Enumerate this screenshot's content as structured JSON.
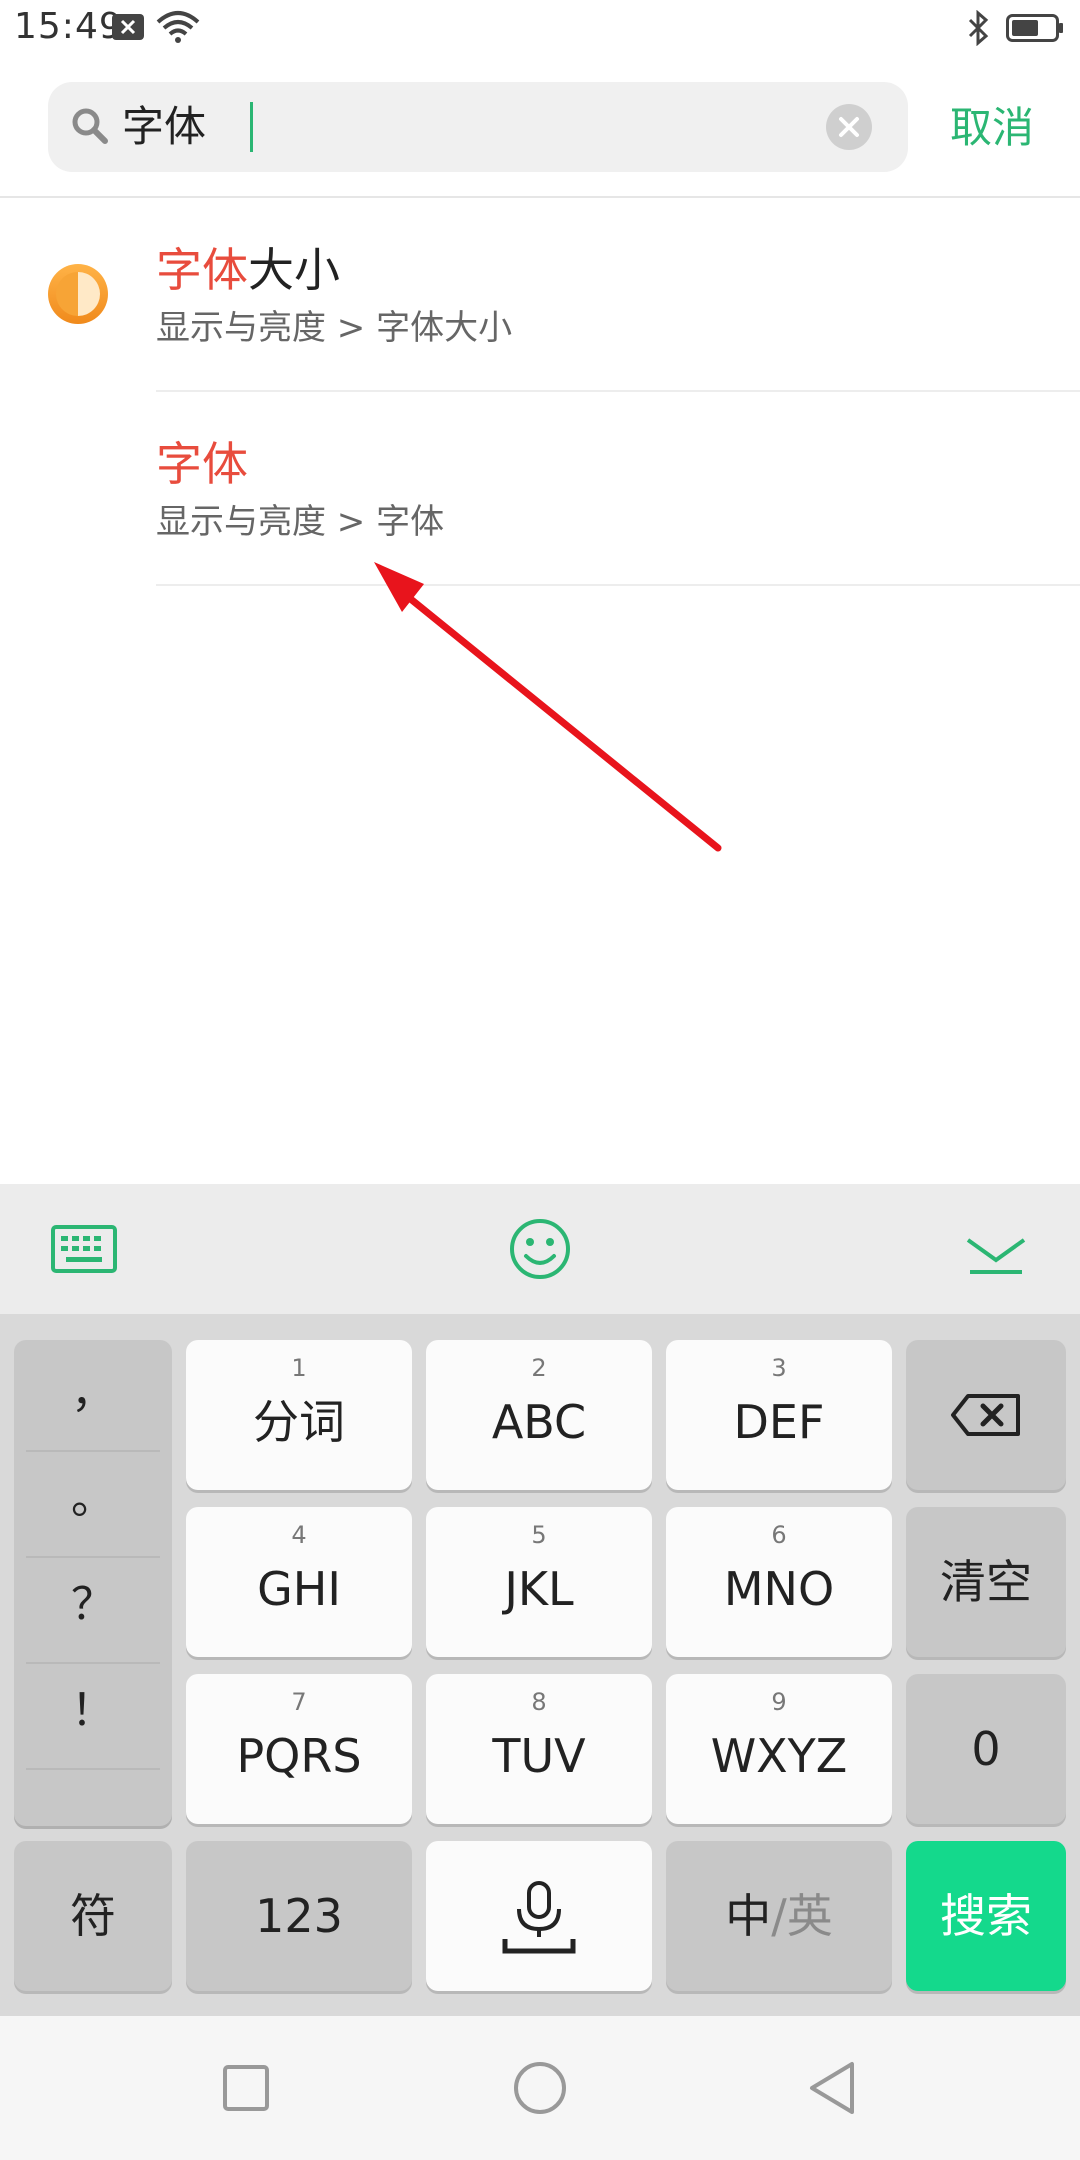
{
  "status_bar": {
    "time": "15:49"
  },
  "search": {
    "query": "字体",
    "cancel_label": "取消"
  },
  "results": [
    {
      "title_highlight": "字体",
      "title_rest": "大小",
      "path": "显示与亮度 > 字体大小"
    },
    {
      "title_highlight": "字体",
      "title_rest": "",
      "path": "显示与亮度 > 字体"
    }
  ],
  "keyboard": {
    "punctuation": [
      "，",
      "。",
      "？",
      "！"
    ],
    "keys": [
      {
        "num": "1",
        "label": "分词"
      },
      {
        "num": "2",
        "label": "ABC"
      },
      {
        "num": "3",
        "label": "DEF"
      },
      {
        "num": "4",
        "label": "GHI"
      },
      {
        "num": "5",
        "label": "JKL"
      },
      {
        "num": "6",
        "label": "MNO"
      },
      {
        "num": "7",
        "label": "PQRS"
      },
      {
        "num": "8",
        "label": "TUV"
      },
      {
        "num": "9",
        "label": "WXYZ"
      }
    ],
    "clear_label": "清空",
    "zero_label": "0",
    "symbol_label": "符",
    "num_label": "123",
    "lang_zh": "中",
    "lang_sep": "/",
    "lang_en": "英",
    "search_label": "搜索"
  },
  "colors": {
    "accent_green": "#2bb673",
    "highlight_red": "#e84c3d",
    "search_key_green": "#14d98c"
  }
}
